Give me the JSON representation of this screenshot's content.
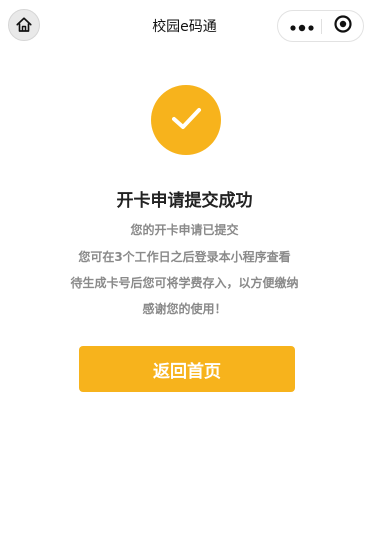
{
  "navbar": {
    "title": "校园e码通",
    "icons": {
      "home": "home-icon",
      "more": "more-dots-icon",
      "close": "close-target-icon"
    }
  },
  "result": {
    "icon": "check-icon",
    "title": "开卡申请提交成功",
    "lines": [
      "您的开卡申请已提交",
      "您可在3个工作日之后登录本小程序查看",
      "待生成卡号后您可将学费存入，以方便缴纳",
      "感谢您的使用！"
    ]
  },
  "actions": {
    "back_label": "返回首页"
  },
  "colors": {
    "accent": "#f7b31c",
    "text_primary": "#222222",
    "text_secondary": "#8a8a8a"
  }
}
